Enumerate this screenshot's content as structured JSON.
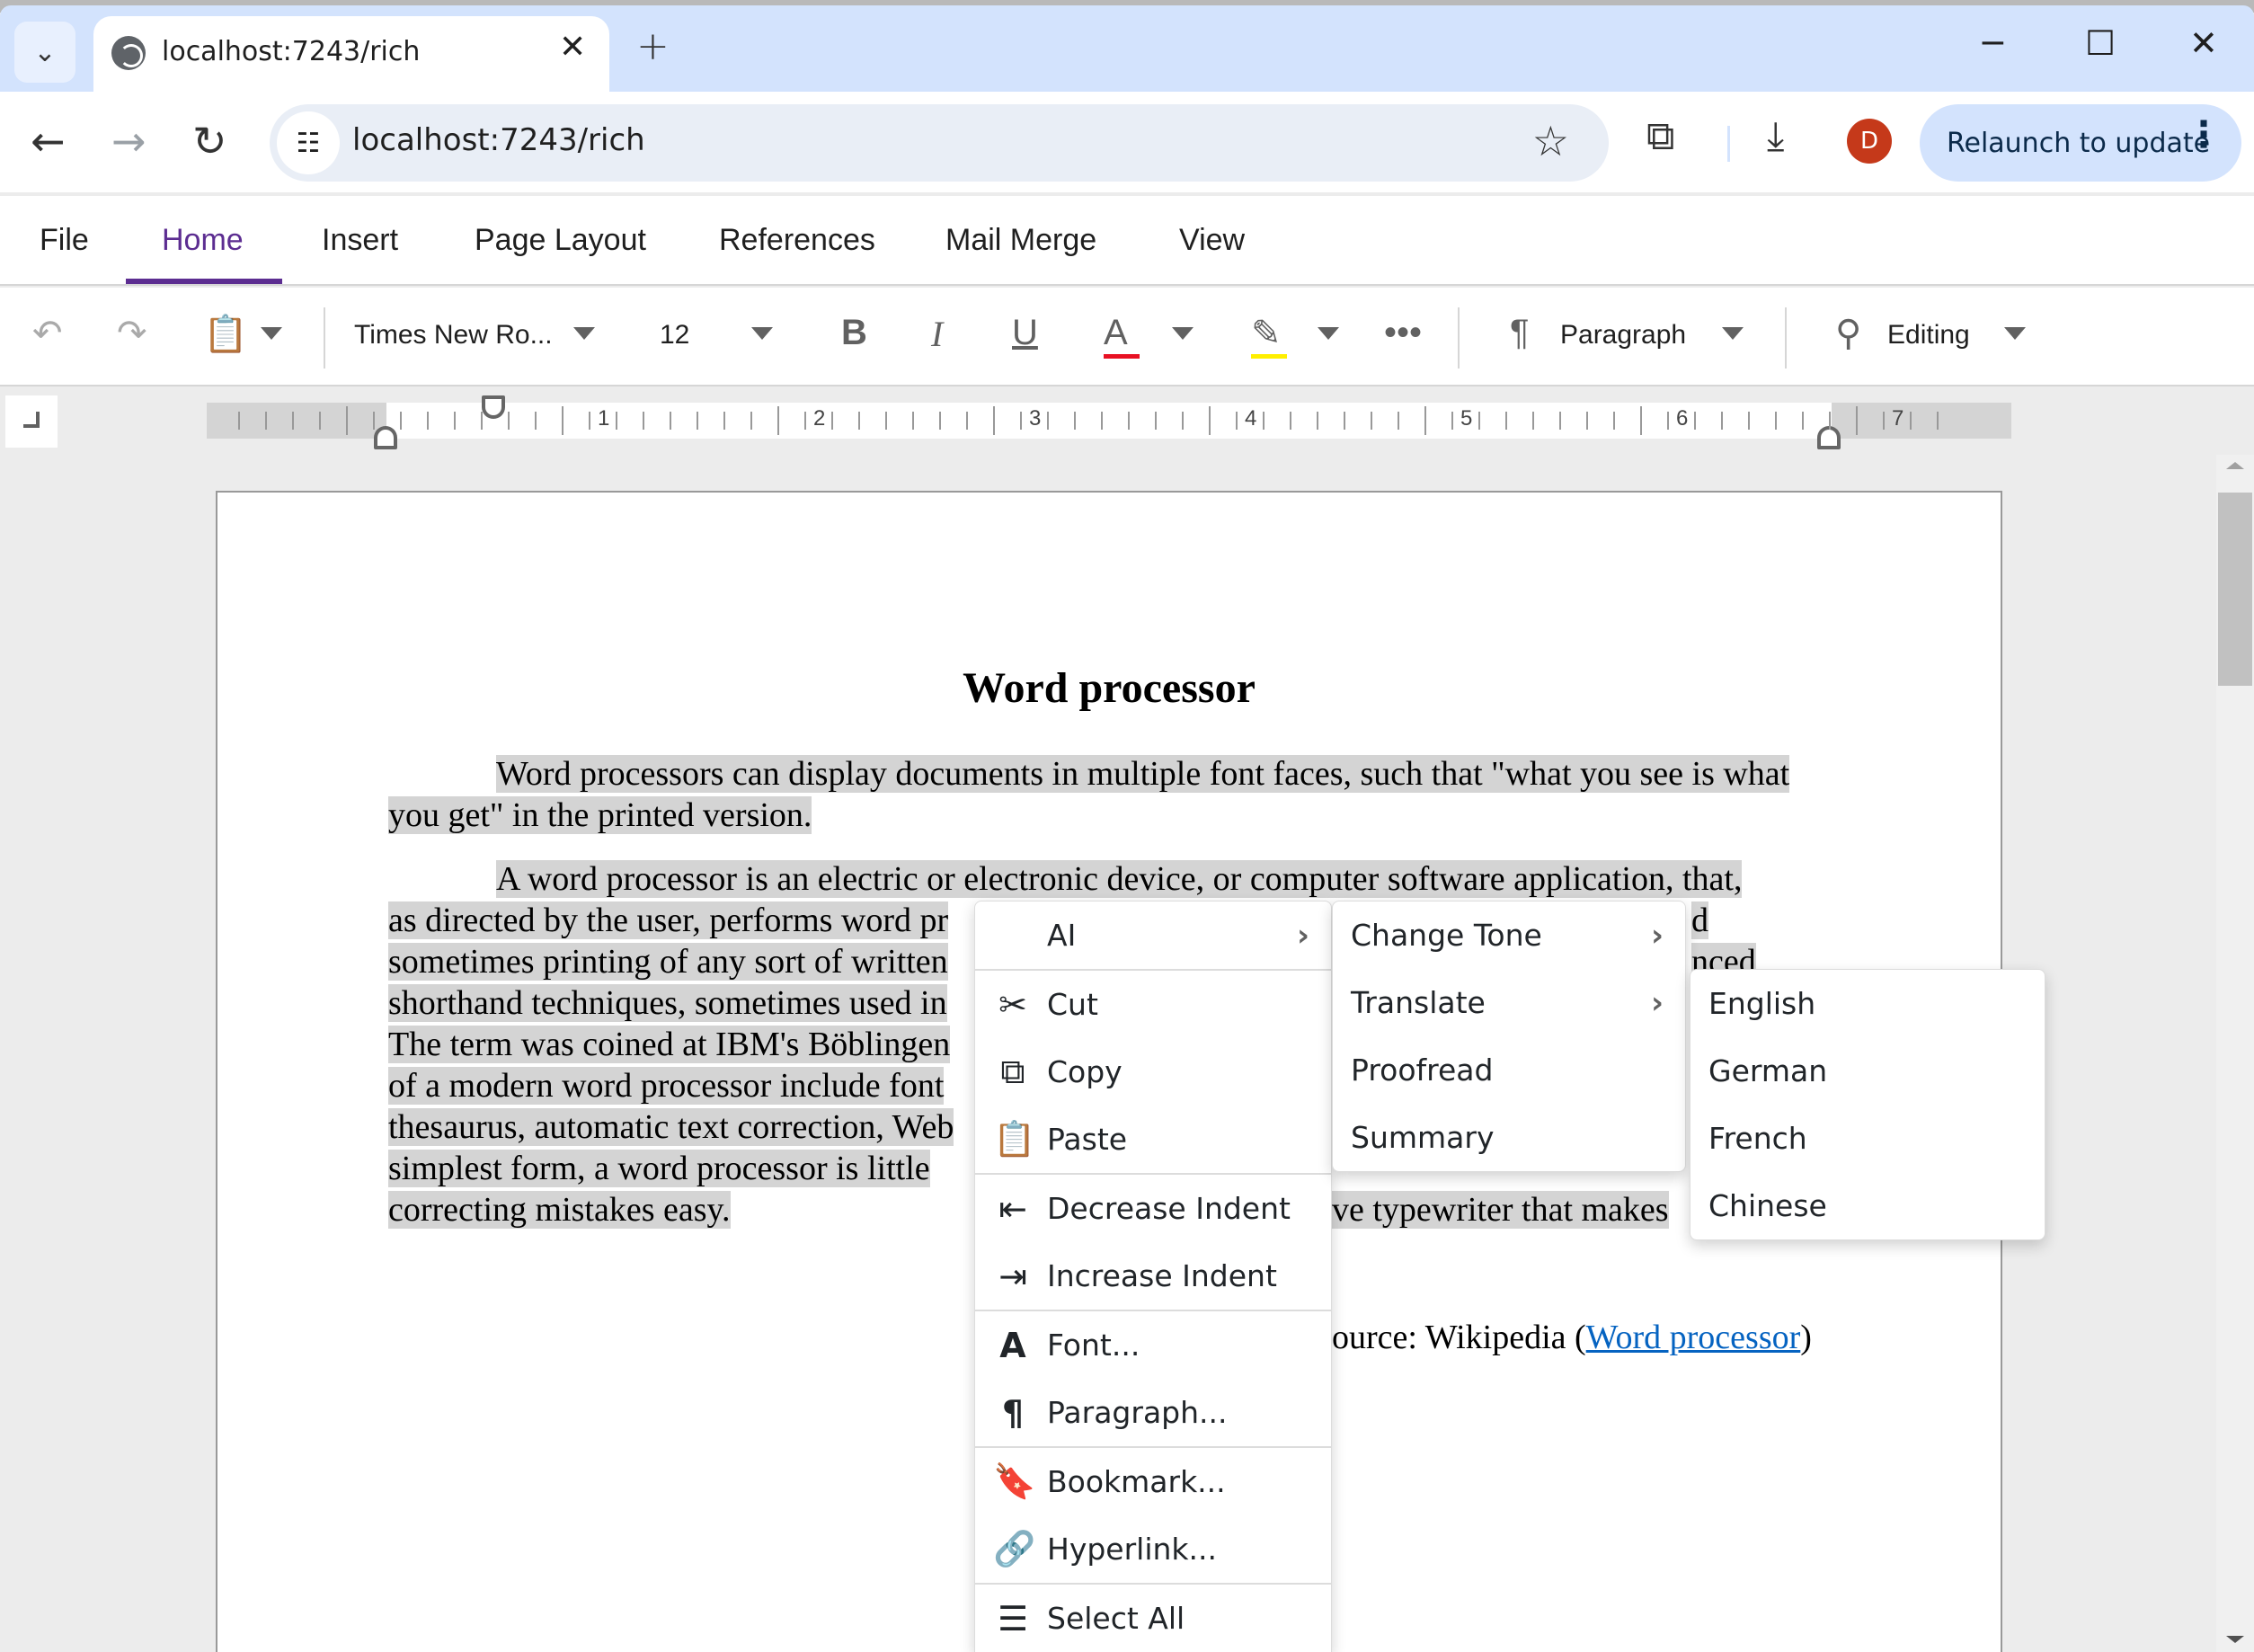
{
  "browser": {
    "tab_title": "localhost:7243/rich",
    "url": "localhost:7243/rich",
    "profile_initial": "D",
    "relaunch_label": "Relaunch to update",
    "icons": {
      "tab_search": "chevron-down-icon",
      "favicon": "globe-icon",
      "close_tab": "close-icon",
      "new_tab": "plus-icon",
      "minimize": "minimize-icon",
      "maximize": "maximize-icon",
      "close_window": "close-icon",
      "back": "arrow-left-icon",
      "forward": "arrow-right-icon",
      "reload": "reload-icon",
      "site_info": "tune-icon",
      "bookmark": "star-icon",
      "extensions": "puzzle-icon",
      "downloads": "download-icon",
      "menu": "more-vert-icon"
    }
  },
  "ribbon": {
    "tabs": [
      {
        "label": "File",
        "active": false
      },
      {
        "label": "Home",
        "active": true
      },
      {
        "label": "Insert",
        "active": false
      },
      {
        "label": "Page Layout",
        "active": false
      },
      {
        "label": "References",
        "active": false
      },
      {
        "label": "Mail Merge",
        "active": false
      },
      {
        "label": "View",
        "active": false
      }
    ],
    "accent_color": "#5c2d91",
    "font_name": "Times New Ro...",
    "font_size": "12",
    "paragraph_label": "Paragraph",
    "editing_label": "Editing",
    "font_color": "#e81123",
    "highlight_color": "#ffef00"
  },
  "ruler": {
    "numbers": [
      "1",
      "2",
      "3",
      "4",
      "5",
      "6",
      "7"
    ]
  },
  "document": {
    "title": "Word processor",
    "paragraph1": "Word processors can display documents in multiple font faces, such that \"what you see is what you get\" in the printed version.",
    "paragraph2_visible_lines": [
      "A word processor is an electric or electronic device, or computer software application, that,",
      "as directed by the user, performs word pr",
      "sometimes printing of any sort of written",
      "shorthand techniques, sometimes used in",
      "The term was coined at IBM's Böblingen",
      "of a modern word processor include font",
      "thesaurus, automatic text correction, Web",
      "simplest form, a word processor is little",
      "correcting mistakes easy."
    ],
    "paragraph2_fragments_right": [
      "d",
      "nced",
      "ve typewriter that makes"
    ],
    "source_prefix": "ource: Wikipedia (",
    "source_link": "Word processor",
    "source_suffix": ")",
    "link_color": "#0563c1",
    "selection_color": "#d4d4d4"
  },
  "context_menu": {
    "items": [
      {
        "label": "AI",
        "icon": "",
        "submenu": true
      },
      {
        "label": "Cut",
        "icon": "scissors-icon"
      },
      {
        "label": "Copy",
        "icon": "copy-icon"
      },
      {
        "label": "Paste",
        "icon": "clipboard-icon"
      },
      {
        "label": "Decrease Indent",
        "icon": "decrease-indent-icon"
      },
      {
        "label": "Increase Indent",
        "icon": "increase-indent-icon"
      },
      {
        "label": "Font...",
        "icon": "font-icon"
      },
      {
        "label": "Paragraph...",
        "icon": "pilcrow-icon"
      },
      {
        "label": "Bookmark...",
        "icon": "bookmark-icon"
      },
      {
        "label": "Hyperlink...",
        "icon": "hyperlink-icon"
      },
      {
        "label": "Select All",
        "icon": "select-all-icon"
      }
    ]
  },
  "ai_menu": {
    "items": [
      {
        "label": "Change Tone",
        "submenu": true
      },
      {
        "label": "Translate",
        "submenu": true
      },
      {
        "label": "Proofread",
        "submenu": false
      },
      {
        "label": "Summary",
        "submenu": false
      }
    ]
  },
  "translate_menu": {
    "items": [
      "English",
      "German",
      "French",
      "Chinese"
    ]
  }
}
